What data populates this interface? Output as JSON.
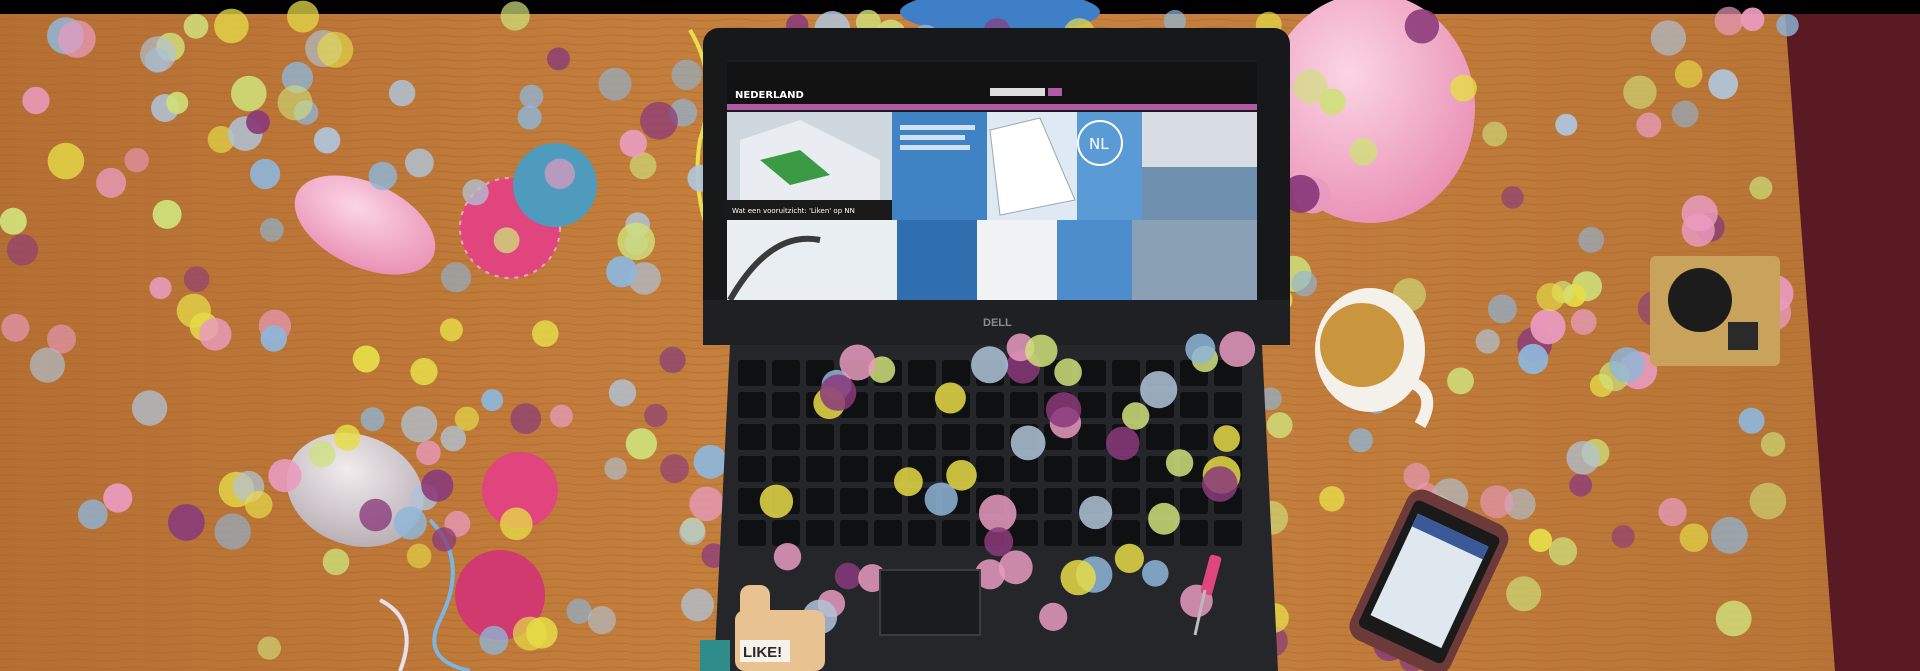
{
  "photo": {
    "laptop": {
      "brand": "DELL",
      "website_brand": "NEDERLAND",
      "nl_badge": "NL",
      "featured_tile_caption": "Wat een vooruitzicht: 'Liken' op NN"
    },
    "thumbs_up_sign": "LIKE!",
    "colors": {
      "table": "#c07a3a",
      "table_dark": "#8e5424",
      "carpet": "#5a1a24",
      "confetti_yellow": "#e6dc48",
      "confetti_blue": "#8fb6d8",
      "confetti_purple": "#8a3a7a",
      "confetti_pink": "#e99bbf",
      "balloon_pink": "#f2a9c6",
      "balloon_blue": "#3f7fc8"
    }
  }
}
